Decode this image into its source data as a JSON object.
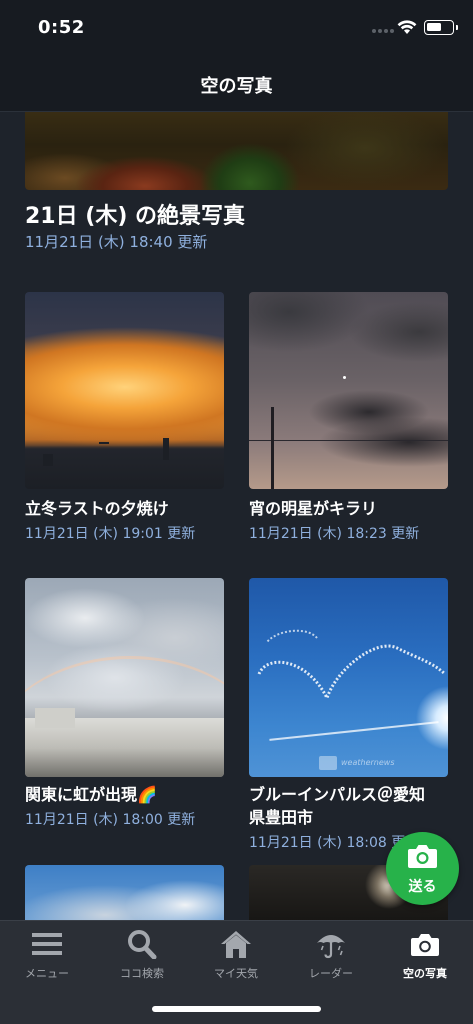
{
  "status_bar": {
    "time": "0:52"
  },
  "header": {
    "title": "空の写真"
  },
  "featured": {
    "title": "21日 (木) の絶景写真",
    "date": "11月21日 (木) 18:40 更新"
  },
  "cards": [
    {
      "title": "立冬ラストの夕焼け",
      "date": "11月21日 (木) 19:01 更新"
    },
    {
      "title": "宵の明星がキラリ",
      "date": "11月21日 (木) 18:23 更新"
    },
    {
      "title": "関東に虹が出現🌈",
      "date": "11月21日 (木) 18:00 更新"
    },
    {
      "title_line1": "ブルーインパルス＠愛知",
      "title_line2": "県豊田市",
      "date": "11月21日 (木) 18:08 更新",
      "watermark": "weathernews"
    }
  ],
  "fab": {
    "label": "送る",
    "icon": "camera-icon"
  },
  "tab_bar": {
    "tabs": [
      {
        "label": "メニュー",
        "icon": "menu-icon",
        "active": false
      },
      {
        "label": "ココ検索",
        "icon": "search-icon",
        "active": false
      },
      {
        "label": "マイ天気",
        "icon": "home-icon",
        "active": false
      },
      {
        "label": "レーダー",
        "icon": "umbrella-icon",
        "active": false
      },
      {
        "label": "空の写真",
        "icon": "camera-icon",
        "active": true
      }
    ]
  },
  "colors": {
    "background": "#1e232b",
    "date_text": "#8fb0de",
    "fab": "#27b24a",
    "tab_bar": "#2b2f36"
  }
}
